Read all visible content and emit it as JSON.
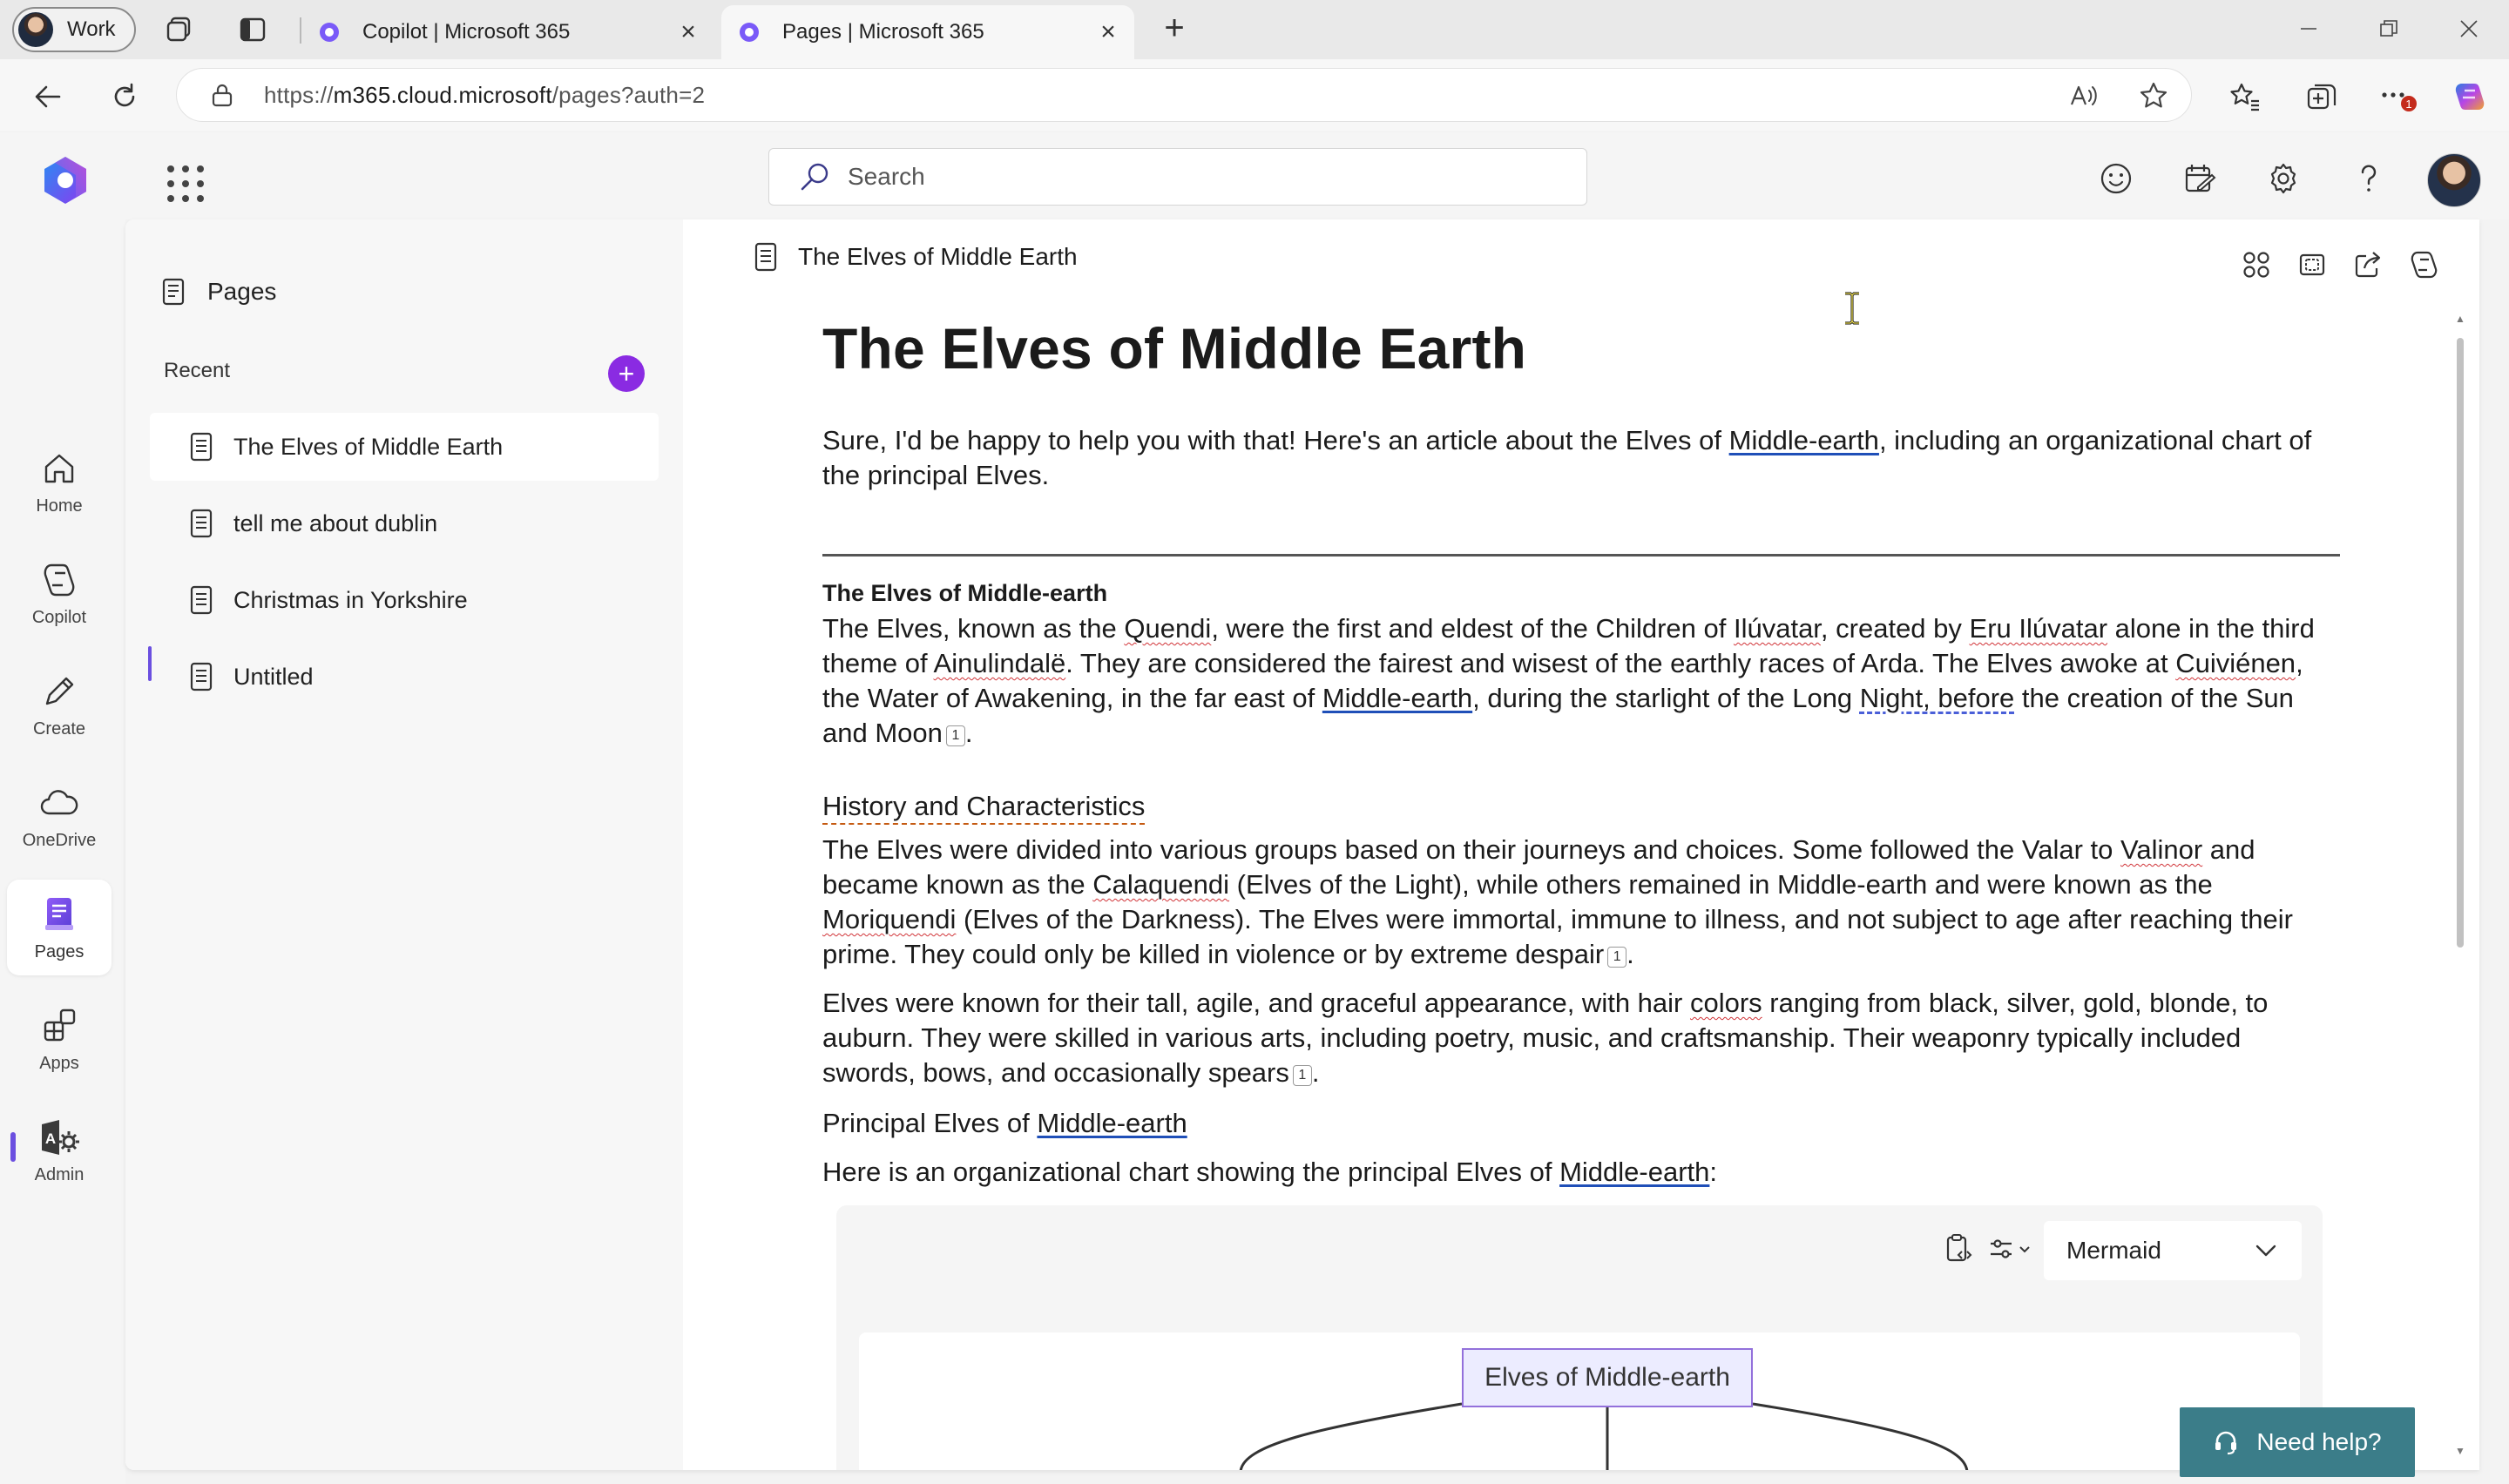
{
  "browser": {
    "profile_label": "Work",
    "tabs": [
      {
        "title": "Copilot | Microsoft 365",
        "active": false
      },
      {
        "title": "Pages | Microsoft 365",
        "active": true
      }
    ],
    "url_host_prefix": "https://",
    "url_host": "m365.cloud.microsoft",
    "url_path": "/pages?auth=2",
    "notification_count": "1"
  },
  "header": {
    "search_placeholder": "Search"
  },
  "rail": {
    "items": [
      {
        "label": "Home",
        "icon": "home-icon"
      },
      {
        "label": "Copilot",
        "icon": "copilot-icon"
      },
      {
        "label": "Create",
        "icon": "create-icon"
      },
      {
        "label": "OneDrive",
        "icon": "onedrive-icon"
      },
      {
        "label": "Pages",
        "icon": "pages-icon",
        "active": true
      },
      {
        "label": "Apps",
        "icon": "apps-icon"
      },
      {
        "label": "Admin",
        "icon": "admin-icon"
      }
    ]
  },
  "panel": {
    "title": "Pages",
    "recent_label": "Recent",
    "add_label": "+",
    "pages": [
      {
        "label": "The Elves of Middle Earth",
        "active": true
      },
      {
        "label": "tell me about dublin"
      },
      {
        "label": "Christmas in Yorkshire"
      },
      {
        "label": "Untitled"
      }
    ]
  },
  "editor": {
    "page_title": "The Elves of Middle Earth",
    "heading": "The Elves of Middle Earth",
    "intro": {
      "a": "Sure, I'd be happy to help you with that! Here's an article about the Elves of ",
      "link": "Middle-earth",
      "b": ", including an organizational chart of the principal Elves."
    },
    "section_title": "The Elves of Middle-earth",
    "para1": {
      "a": "The Elves, known as the ",
      "quendi": "Quendi",
      "b": ", were the first and eldest of the Children of ",
      "iluvatar": "Ilúvatar",
      "c": ", created by ",
      "eru": "Eru Ilúvatar",
      "d": " alone in the third theme of ",
      "ainu": "Ainulindalë",
      "e": ". They are considered the fairest and wisest of the earthly races of Arda. The Elves awoke at ",
      "cuiv": "Cuiviénen",
      "f": ", the Water of Awakening, in the far east of ",
      "me": "Middle-earth",
      "g": ", during the starlight of the Long ",
      "night": "Night, before",
      "h": " the creation of the Sun and Moon",
      "cite": "1",
      "i": "."
    },
    "history_title": "History and Characteristics",
    "para2": {
      "a": "The Elves were divided into various groups based on their journeys and choices. Some followed the Valar to ",
      "valinor": "Valinor",
      "b": " and became known as the ",
      "cala": "Calaquendi",
      "c": " (Elves of the Light), while others remained in Middle-earth and were known as the ",
      "mori": "Moriquendi",
      "d": " (Elves of the Darkness). The Elves were immortal, immune to illness, and not subject to age after reaching their prime. They could only be killed in violence or by extreme despair",
      "cite": "1",
      "e": "."
    },
    "para3": {
      "a": "Elves were known for their tall, agile, and graceful appearance, with hair ",
      "colors": "colors",
      "b": " ranging from black, silver, gold, blonde, to auburn. They were skilled in various arts, including poetry, music, and craftsmanship. Their weaponry typically included swords, bows, and occasionally spears",
      "cite": "1",
      "c": "."
    },
    "principal": {
      "a": "Principal Elves of ",
      "link": "Middle-earth"
    },
    "here": {
      "a": "Here is an organizational chart showing the principal Elves of ",
      "link": "Middle-earth",
      "b": ":"
    },
    "code_block": {
      "language": "Mermaid",
      "root_node": "Elves of Middle-earth"
    }
  },
  "help": {
    "label": "Need help?"
  },
  "colors": {
    "accent": "#8a2be2",
    "help_bg": "#3b7d89",
    "rail_indicator": "#6b4fe0",
    "node_fill": "#ececff",
    "node_border": "#9370db"
  }
}
